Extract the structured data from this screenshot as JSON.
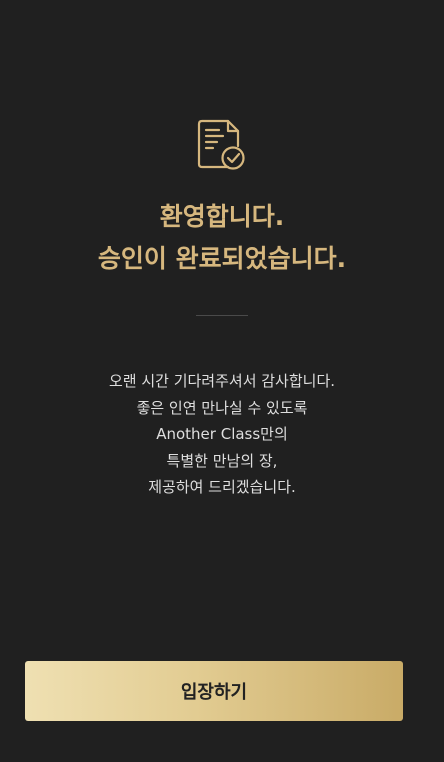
{
  "icon": "document-check-icon",
  "colors": {
    "background": "#202020",
    "accent": "#d6b77e",
    "text": "#dedede",
    "button_gradient": [
      "#efe0b2",
      "#c9ab67"
    ]
  },
  "welcome": {
    "title_line1": "환영합니다.",
    "title_line2": "승인이 완료되었습니다."
  },
  "message": {
    "lines": [
      "오랜 시간 기다려주셔서 감사합니다.",
      "좋은 인연 만나실 수 있도록",
      "Another Class만의",
      "특별한 만남의 장,",
      "제공하여 드리겠습니다."
    ]
  },
  "actions": {
    "enter_label": "입장하기"
  }
}
